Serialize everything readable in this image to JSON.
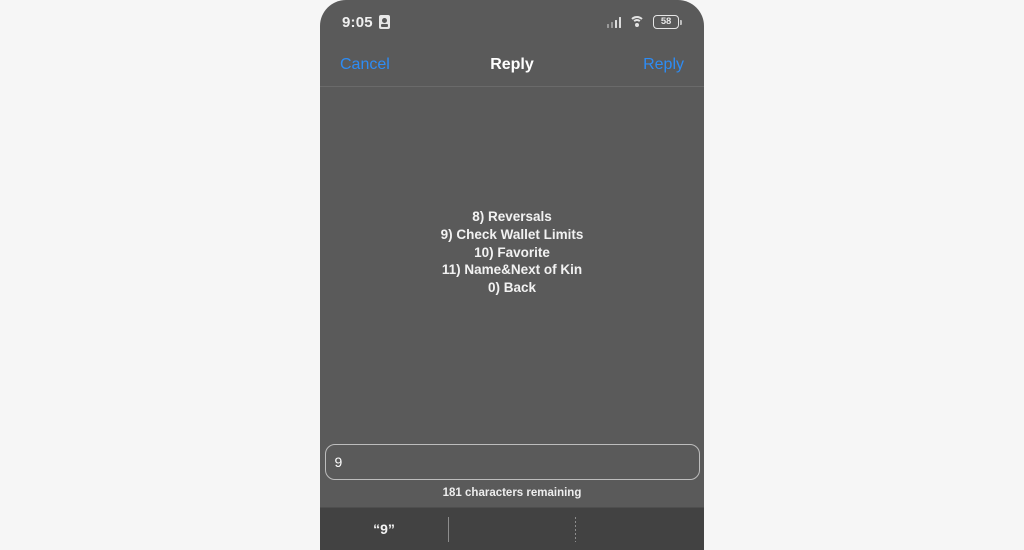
{
  "page": {
    "background_color": "#f6f6f6",
    "phone_screen_color": "#5a5a5a",
    "accent_color": "#2d8cf5"
  },
  "status_bar": {
    "time": "9:05",
    "recording_icon": "id-badge-icon",
    "signal_icon": "cellular-signal-icon",
    "wifi_icon": "wifi-icon",
    "battery_level": "58",
    "battery_icon": "battery-icon"
  },
  "nav_bar": {
    "cancel_label": "Cancel",
    "title": "Reply",
    "reply_label": "Reply"
  },
  "message": {
    "lines": [
      "8) Reversals",
      "9) Check Wallet Limits",
      "10) Favorite",
      "11) Name&Next of Kin",
      "0) Back"
    ]
  },
  "reply_field": {
    "value": "9",
    "placeholder": "",
    "counter": "181 characters remaining"
  },
  "keyboard": {
    "predictions": [
      {
        "label": "“9”",
        "divider": "none"
      },
      {
        "label": "",
        "divider": "solid"
      },
      {
        "label": "",
        "divider": "dotted"
      }
    ]
  }
}
